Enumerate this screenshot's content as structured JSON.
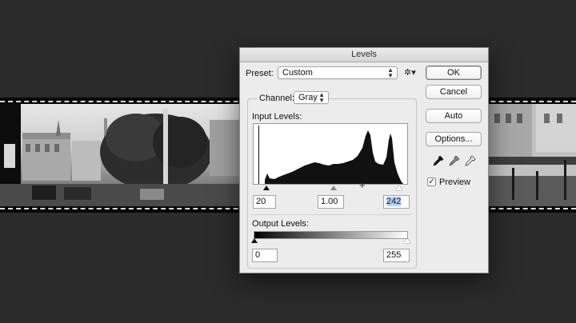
{
  "dialog": {
    "title": "Levels",
    "preset_label": "Preset:",
    "preset_value": "Custom",
    "channel_label": "Channel:",
    "channel_value": "Gray",
    "input_levels_label": "Input Levels:",
    "input_black": "20",
    "input_gamma": "1.00",
    "input_white": "242",
    "output_levels_label": "Output Levels:",
    "output_black": "0",
    "output_white": "255"
  },
  "buttons": {
    "ok": "OK",
    "cancel": "Cancel",
    "auto": "Auto",
    "options": "Options..."
  },
  "preview": {
    "label": "Preview",
    "checked": true
  },
  "icons": {
    "preset_menu": "gear-icon",
    "black_eyedropper": "eyedropper-black-icon",
    "gray_eyedropper": "eyedropper-gray-icon",
    "white_eyedropper": "eyedropper-white-icon"
  },
  "colors": {
    "background": "#2b2b2b",
    "dialog": "#ececec",
    "selection": "#b5d5ff"
  }
}
